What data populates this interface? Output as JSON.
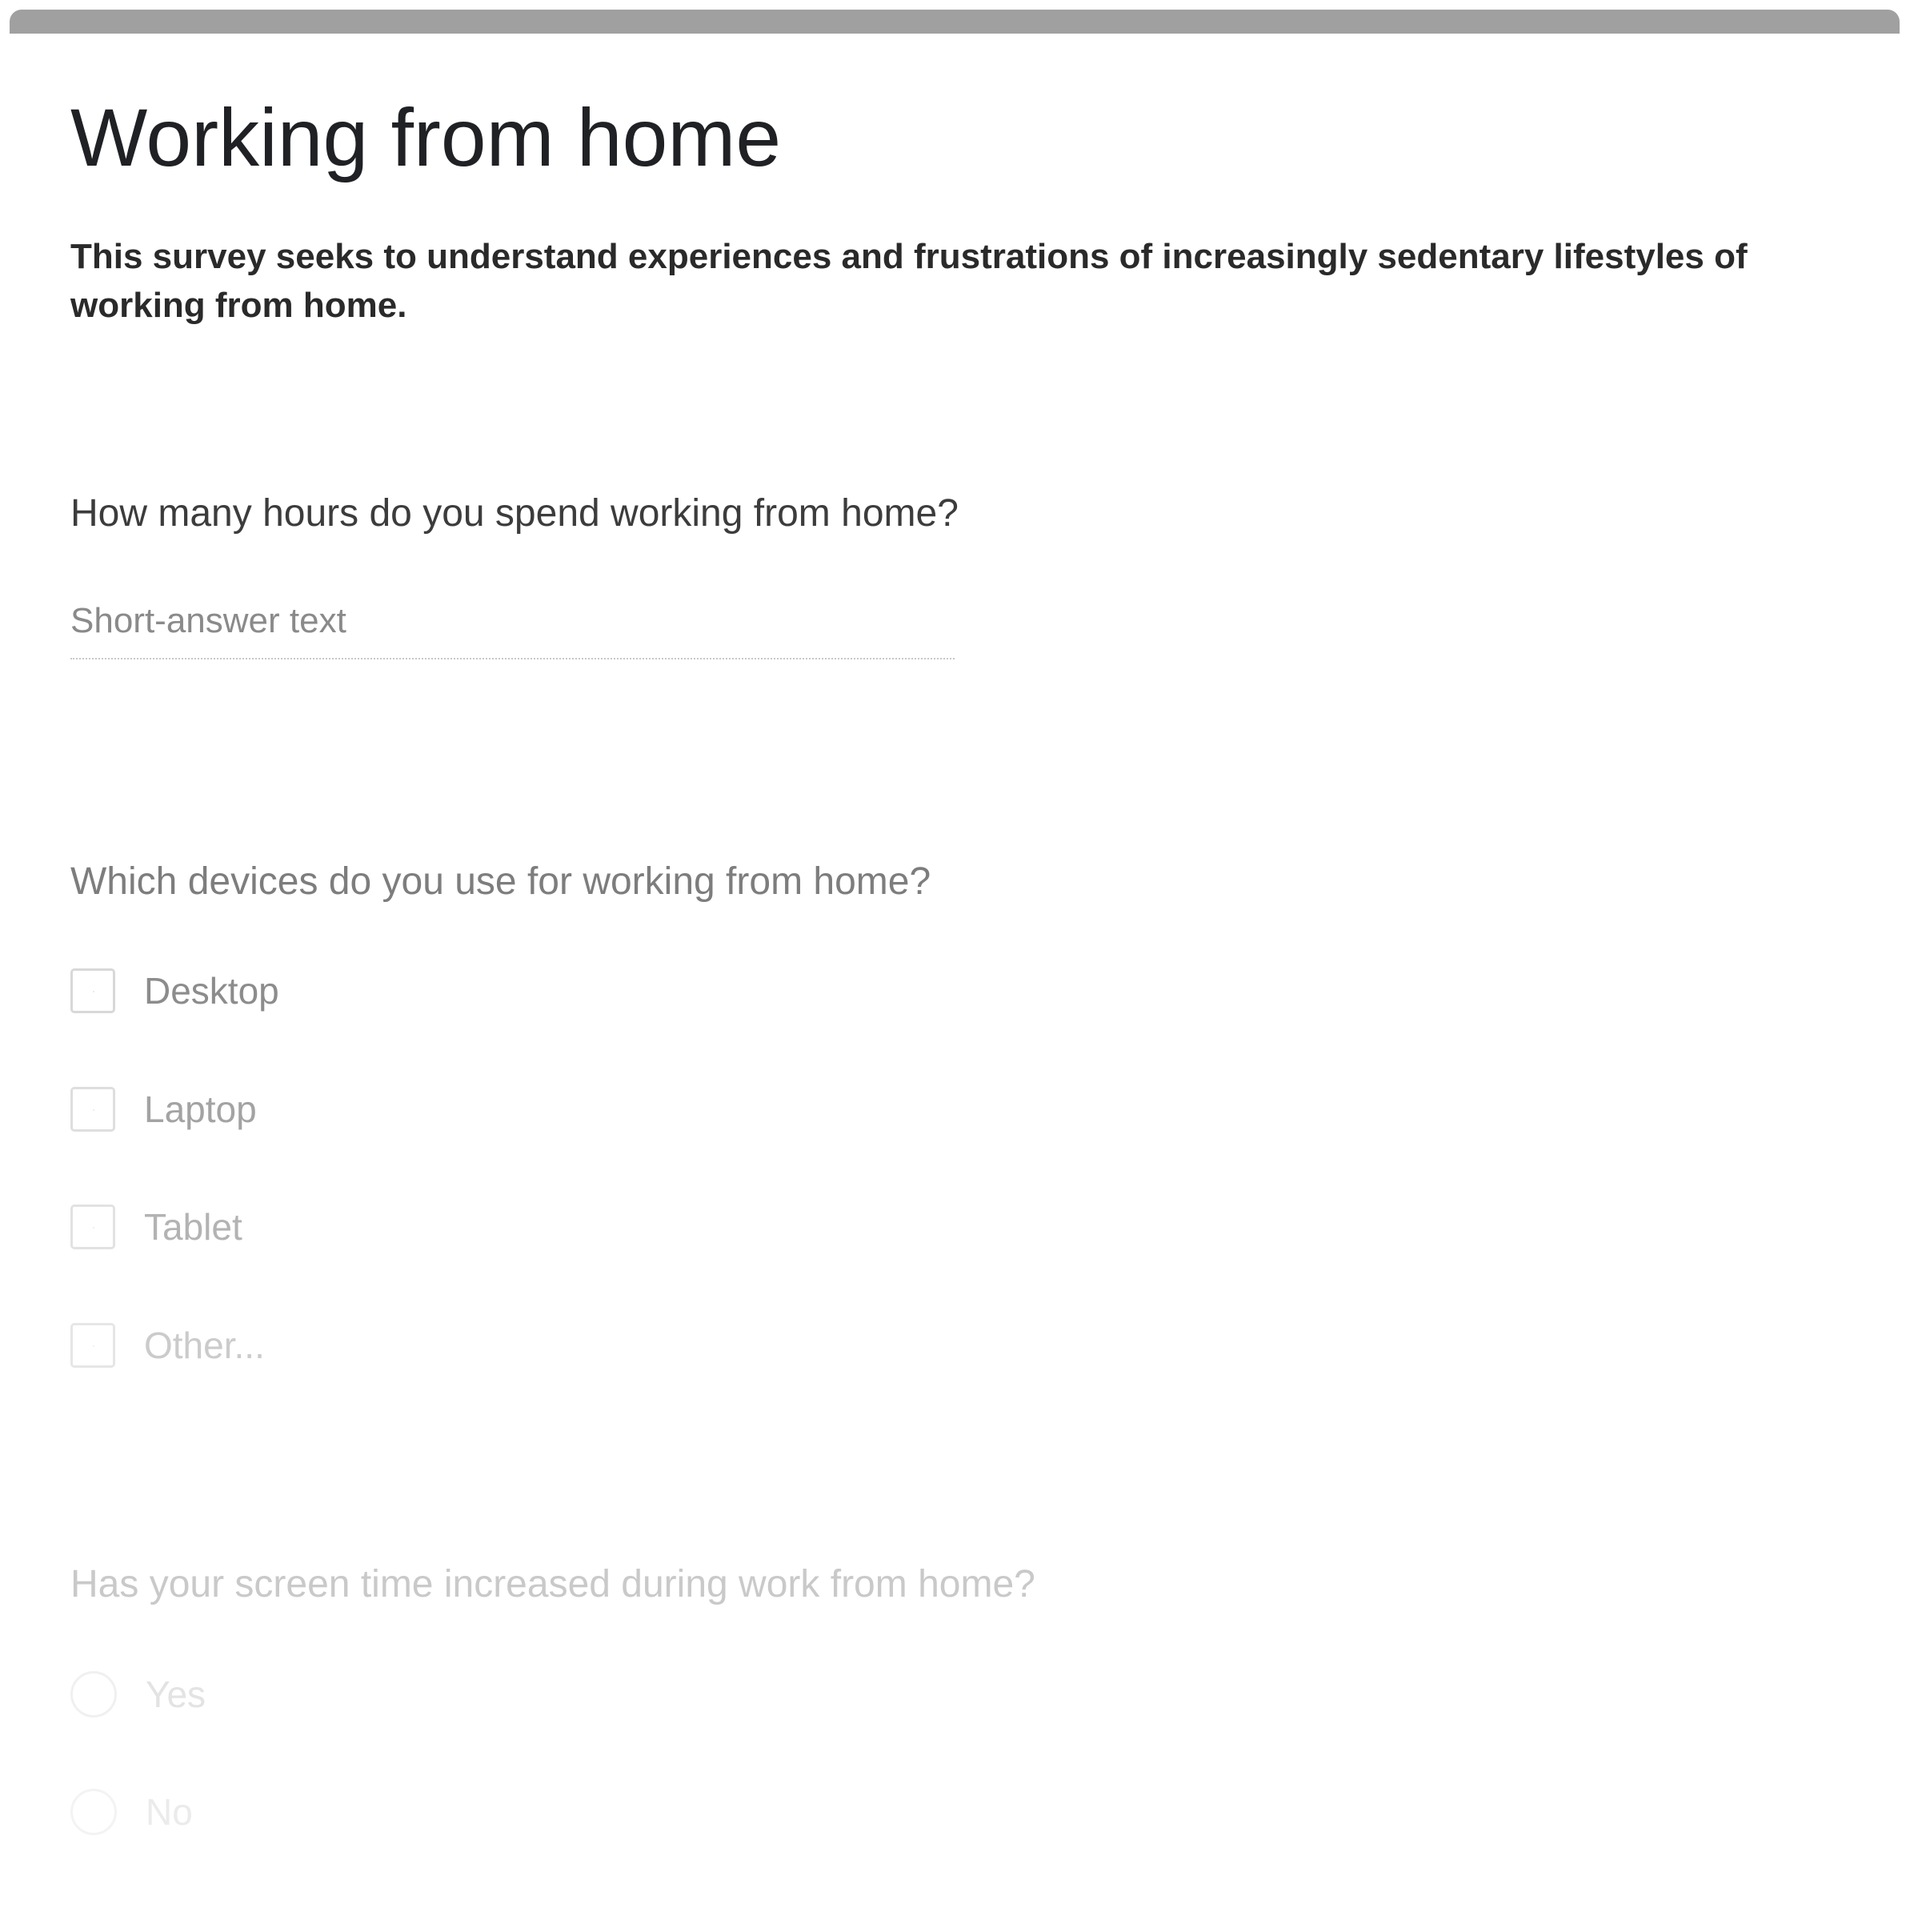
{
  "form": {
    "title": "Working from home",
    "description": "This survey seeks to understand experiences and frustrations of increasingly sedentary lifestyles of working from home."
  },
  "questions": [
    {
      "text": "How many hours do you spend working from home?",
      "type": "short-answer",
      "placeholder": "Short-answer text"
    },
    {
      "text": "Which devices do you use for working from home?",
      "type": "checkbox",
      "options": [
        "Desktop",
        "Laptop",
        "Tablet",
        "Other..."
      ]
    },
    {
      "text": "Has your screen time increased during work from home?",
      "type": "radio",
      "options": [
        "Yes",
        "No"
      ]
    }
  ],
  "colors": {
    "top_bar": "#a0a0a0",
    "title": "#202124",
    "description": "#2a2a2a"
  }
}
